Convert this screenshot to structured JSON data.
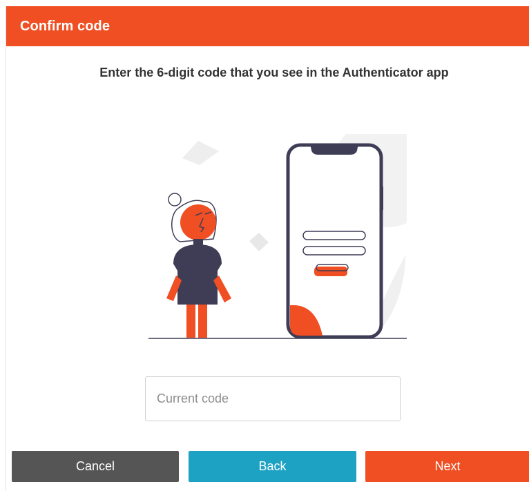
{
  "dialog": {
    "title": "Confirm code",
    "instructions": "Enter the 6-digit code that you see in the Authenticator app"
  },
  "code_input": {
    "placeholder": "Current code",
    "value": ""
  },
  "buttons": {
    "cancel": "Cancel",
    "back": "Back",
    "next": "Next"
  },
  "colors": {
    "accent": "#f04e23",
    "back_button": "#1ea2c4",
    "cancel_button": "#555555",
    "phone_frame": "#3f3d56"
  },
  "illustration": {
    "icon": "person-with-phone-illustration"
  }
}
